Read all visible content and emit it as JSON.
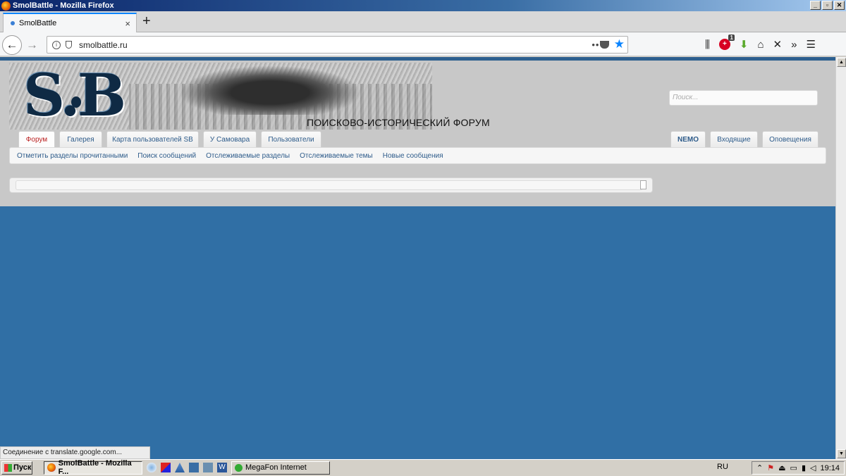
{
  "window": {
    "title": "SmolBattle - Mozilla Firefox",
    "buttons": [
      "_",
      "▫",
      "✕"
    ]
  },
  "browser": {
    "tab_title": "SmolBattle",
    "tab_close": "×",
    "new_tab": "+",
    "url": "smolbattle.ru",
    "page_actions": "•••",
    "addon_badge_count": "1"
  },
  "site": {
    "logo": "S.B",
    "subtitle": "ПОИСКОВО-ИСТОРИЧЕСКИЙ ФОРУМ",
    "search_placeholder": "Поиск...",
    "nav_tabs": [
      {
        "label": "Форум",
        "active": true
      },
      {
        "label": "Галерея"
      },
      {
        "label": "Карта пользователей SB"
      },
      {
        "label": "У Самовара"
      },
      {
        "label": "Пользователи"
      }
    ],
    "user_tabs": [
      {
        "label": "NEMO"
      },
      {
        "label": "Входящие"
      },
      {
        "label": "Оповещения"
      }
    ],
    "sub_links": [
      "Отметить разделы прочитанными",
      "Поиск сообщений",
      "Отслеживаемые разделы",
      "Отслеживаемые темы",
      "Новые сообщения"
    ],
    "colors": {
      "page_background": "#306fa5",
      "header_band": "#c8c8c8",
      "link": "#2d5b8a",
      "active_tab": "#bb2222"
    }
  },
  "status_bar": {
    "text": "Соединение с translate.google.com..."
  },
  "taskbar": {
    "start_label": "Пуск",
    "tasks": [
      {
        "label": "SmolBattle - Mozilla F...",
        "pressed": true
      },
      {
        "label": "MegaFon Internet",
        "pressed": false
      }
    ],
    "language": "RU",
    "clock": "19:14"
  }
}
